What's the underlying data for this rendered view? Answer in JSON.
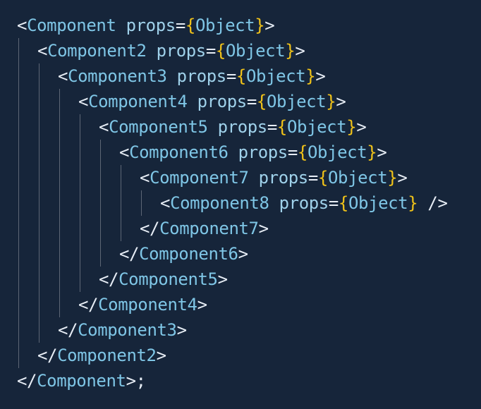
{
  "colors": {
    "background": "#16253a",
    "bracket": "#e7edf5",
    "tag_name": "#7fc6e6",
    "attribute": "#9fd1ea",
    "brace": "#f1c319",
    "object": "#7fc6e6",
    "indent_guide": "#5d6675"
  },
  "code": {
    "attr_name": "props",
    "attr_value": "Object",
    "lines": [
      {
        "kind": "open",
        "depth": 0,
        "tag": "Component"
      },
      {
        "kind": "open",
        "depth": 1,
        "tag": "Component2"
      },
      {
        "kind": "open",
        "depth": 2,
        "tag": "Component3"
      },
      {
        "kind": "open",
        "depth": 3,
        "tag": "Component4"
      },
      {
        "kind": "open",
        "depth": 4,
        "tag": "Component5"
      },
      {
        "kind": "open",
        "depth": 5,
        "tag": "Component6"
      },
      {
        "kind": "open",
        "depth": 6,
        "tag": "Component7"
      },
      {
        "kind": "selfclose",
        "depth": 7,
        "tag": "Component8"
      },
      {
        "kind": "close",
        "depth": 6,
        "tag": "Component7"
      },
      {
        "kind": "close",
        "depth": 5,
        "tag": "Component6"
      },
      {
        "kind": "close",
        "depth": 4,
        "tag": "Component5"
      },
      {
        "kind": "close",
        "depth": 3,
        "tag": "Component4"
      },
      {
        "kind": "close",
        "depth": 2,
        "tag": "Component3"
      },
      {
        "kind": "close",
        "depth": 1,
        "tag": "Component2"
      },
      {
        "kind": "close",
        "depth": 0,
        "tag": "Component",
        "suffix": ";"
      }
    ]
  }
}
